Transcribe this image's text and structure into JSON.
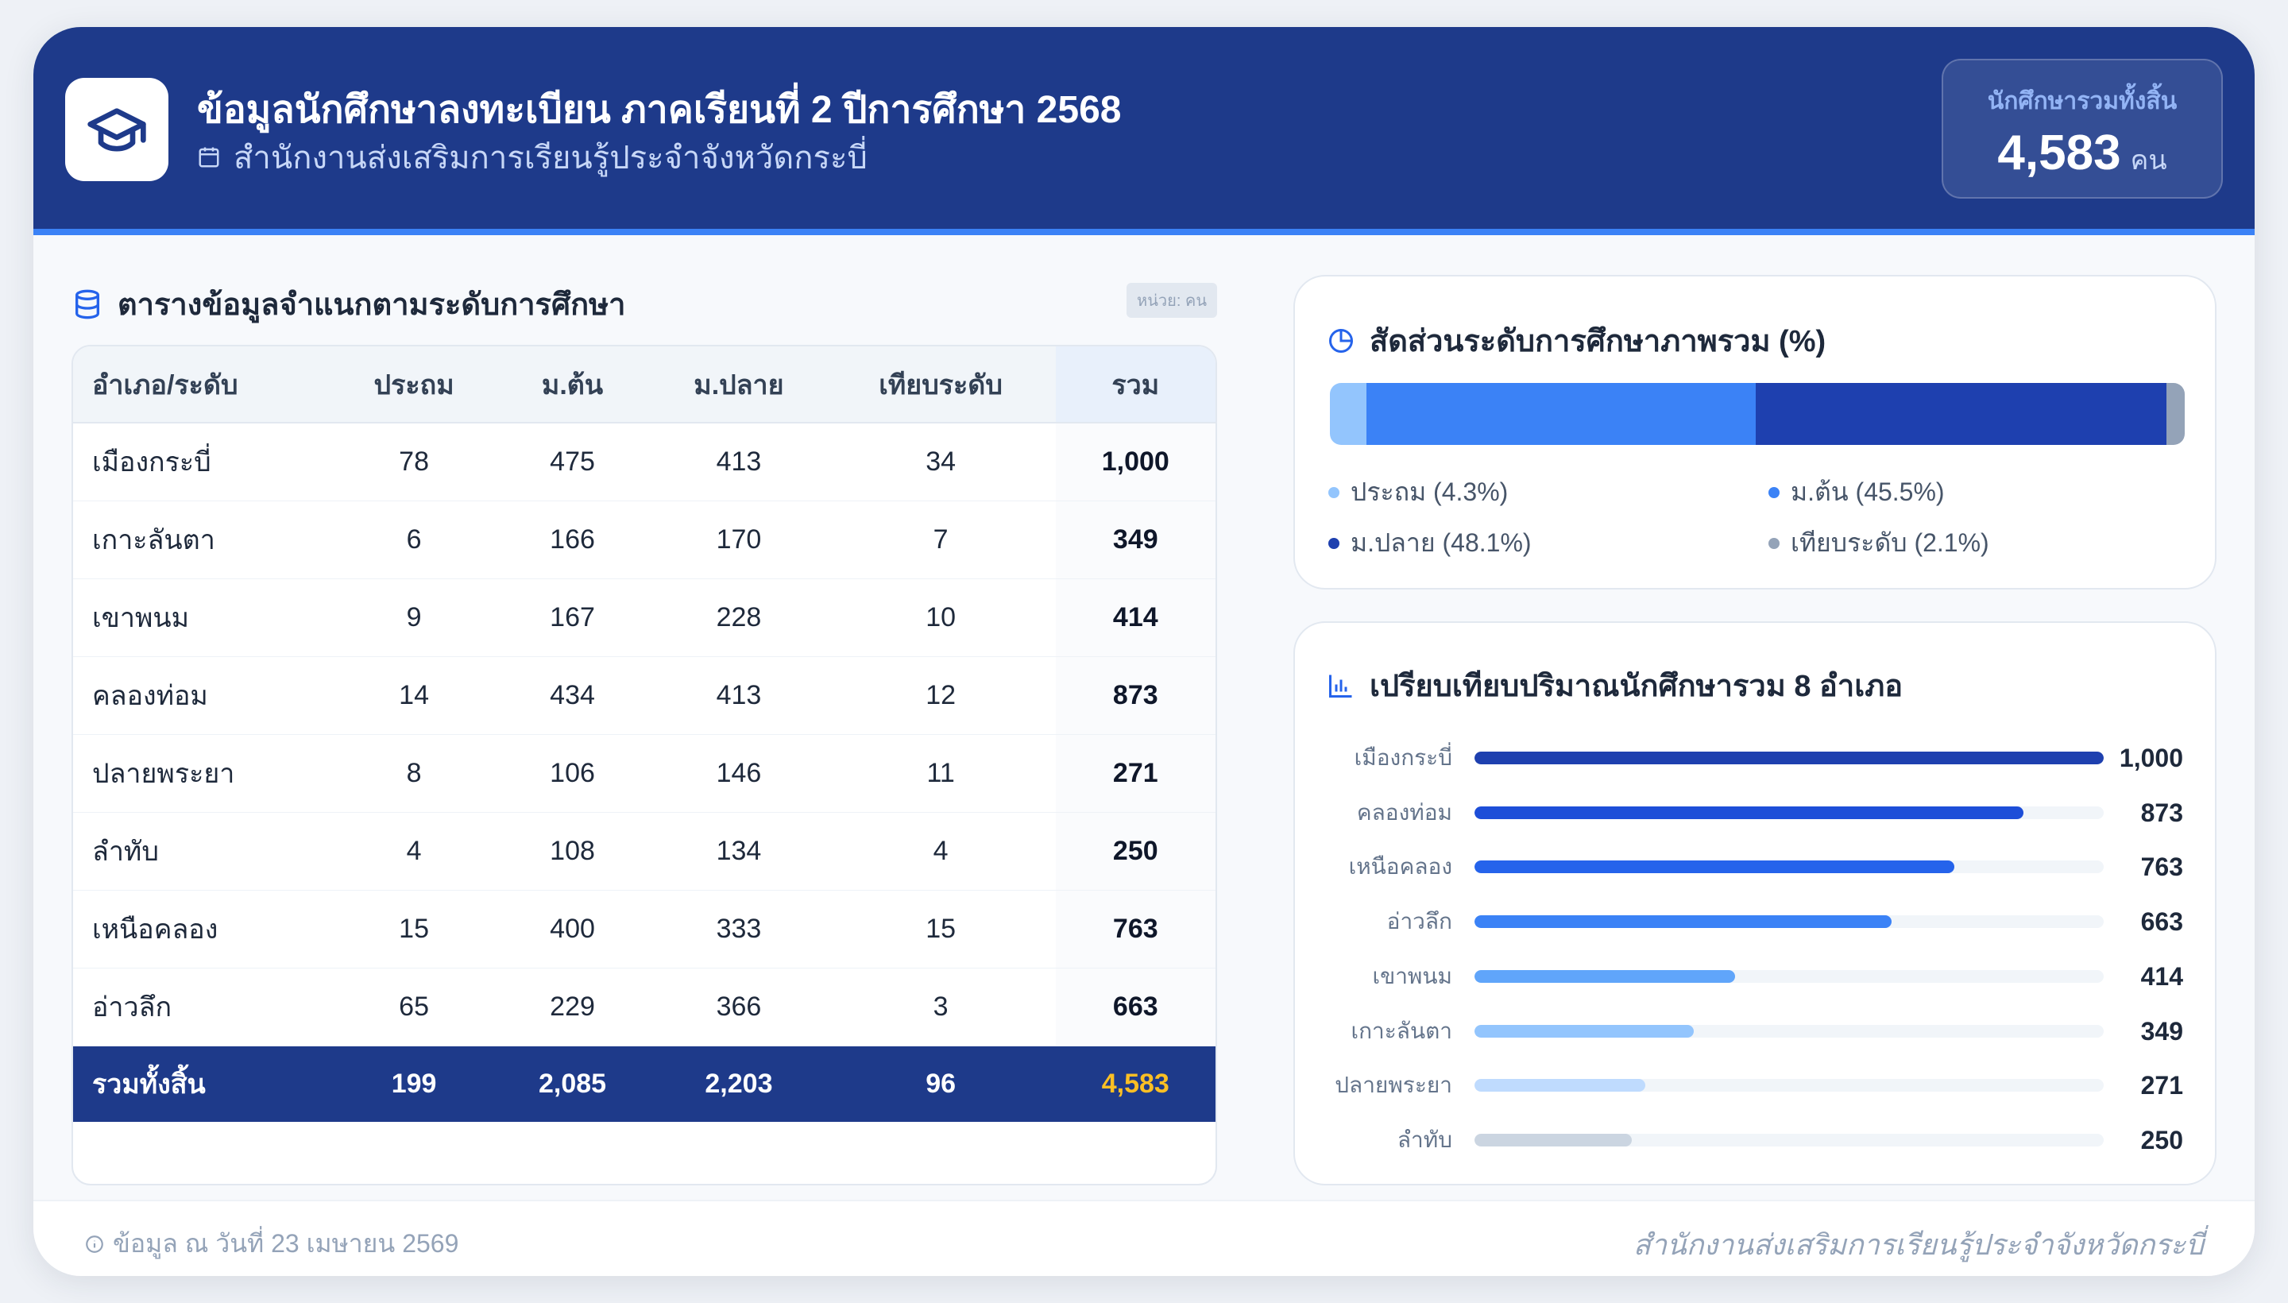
{
  "header": {
    "title": "ข้อมูลนักศึกษาลงทะเบียน ภาคเรียนที่ 2 ปีการศึกษา 2568",
    "subtitle": "สำนักงานส่งเสริมการเรียนรู้ประจำจังหวัดกระบี่",
    "logo_icon": "graduation-cap-icon",
    "total_label": "นักศึกษารวมทั้งสิ้น",
    "total_value": "4,583",
    "total_unit": "คน"
  },
  "table_section": {
    "title": "ตารางข้อมูลจำแนกตามระดับการศึกษา",
    "unit_tag": "หน่วย: คน",
    "columns": [
      "อำเภอ/ระดับ",
      "ประถม",
      "ม.ต้น",
      "ม.ปลาย",
      "เทียบระดับ",
      "รวม"
    ],
    "rows": [
      [
        "เมืองกระบี่",
        "78",
        "475",
        "413",
        "34",
        "1,000"
      ],
      [
        "เกาะลันตา",
        "6",
        "166",
        "170",
        "7",
        "349"
      ],
      [
        "เขาพนม",
        "9",
        "167",
        "228",
        "10",
        "414"
      ],
      [
        "คลองท่อม",
        "14",
        "434",
        "413",
        "12",
        "873"
      ],
      [
        "ปลายพระยา",
        "8",
        "106",
        "146",
        "11",
        "271"
      ],
      [
        "ลำทับ",
        "4",
        "108",
        "134",
        "4",
        "250"
      ],
      [
        "เหนือคลอง",
        "15",
        "400",
        "333",
        "15",
        "763"
      ],
      [
        "อ่าวลึก",
        "65",
        "229",
        "366",
        "3",
        "663"
      ]
    ],
    "footer_row": [
      "รวมทั้งสิ้น",
      "199",
      "2,085",
      "2,203",
      "96",
      "4,583"
    ]
  },
  "ratio_panel": {
    "title": "สัดส่วนระดับการศึกษาภาพรวม (%)",
    "segments": [
      {
        "label": "ประถม (4.3%)",
        "percent": 4.3,
        "color": "#93c5fd"
      },
      {
        "label": "ม.ต้น (45.5%)",
        "percent": 45.5,
        "color": "#3b82f6"
      },
      {
        "label": "ม.ปลาย (48.1%)",
        "percent": 48.1,
        "color": "#1e40af"
      },
      {
        "label": "เทียบระดับ (2.1%)",
        "percent": 2.1,
        "color": "#94a3b8"
      }
    ]
  },
  "compare_panel": {
    "title": "เปรียบเทียบปริมาณนักศึกษารวม 8 อำเภอ",
    "max": 1000,
    "bars": [
      {
        "label": "เมืองกระบี่",
        "value": 1000,
        "display": "1,000",
        "color": "#1e40af"
      },
      {
        "label": "คลองท่อม",
        "value": 873,
        "display": "873",
        "color": "#1d4ed8"
      },
      {
        "label": "เหนือคลอง",
        "value": 763,
        "display": "763",
        "color": "#2563eb"
      },
      {
        "label": "อ่าวลึก",
        "value": 663,
        "display": "663",
        "color": "#3b82f6"
      },
      {
        "label": "เขาพนม",
        "value": 414,
        "display": "414",
        "color": "#60a5fa"
      },
      {
        "label": "เกาะลันตา",
        "value": 349,
        "display": "349",
        "color": "#93c5fd"
      },
      {
        "label": "ปลายพระยา",
        "value": 271,
        "display": "271",
        "color": "#bfdbfe"
      },
      {
        "label": "ลำทับ",
        "value": 250,
        "display": "250",
        "color": "#cbd5e1"
      }
    ]
  },
  "footer": {
    "left": "ข้อมูล ณ วันที่ 23 เมษายน 2569",
    "right": "สำนักงานส่งเสริมการเรียนรู้ประจำจังหวัดกระบี่"
  }
}
